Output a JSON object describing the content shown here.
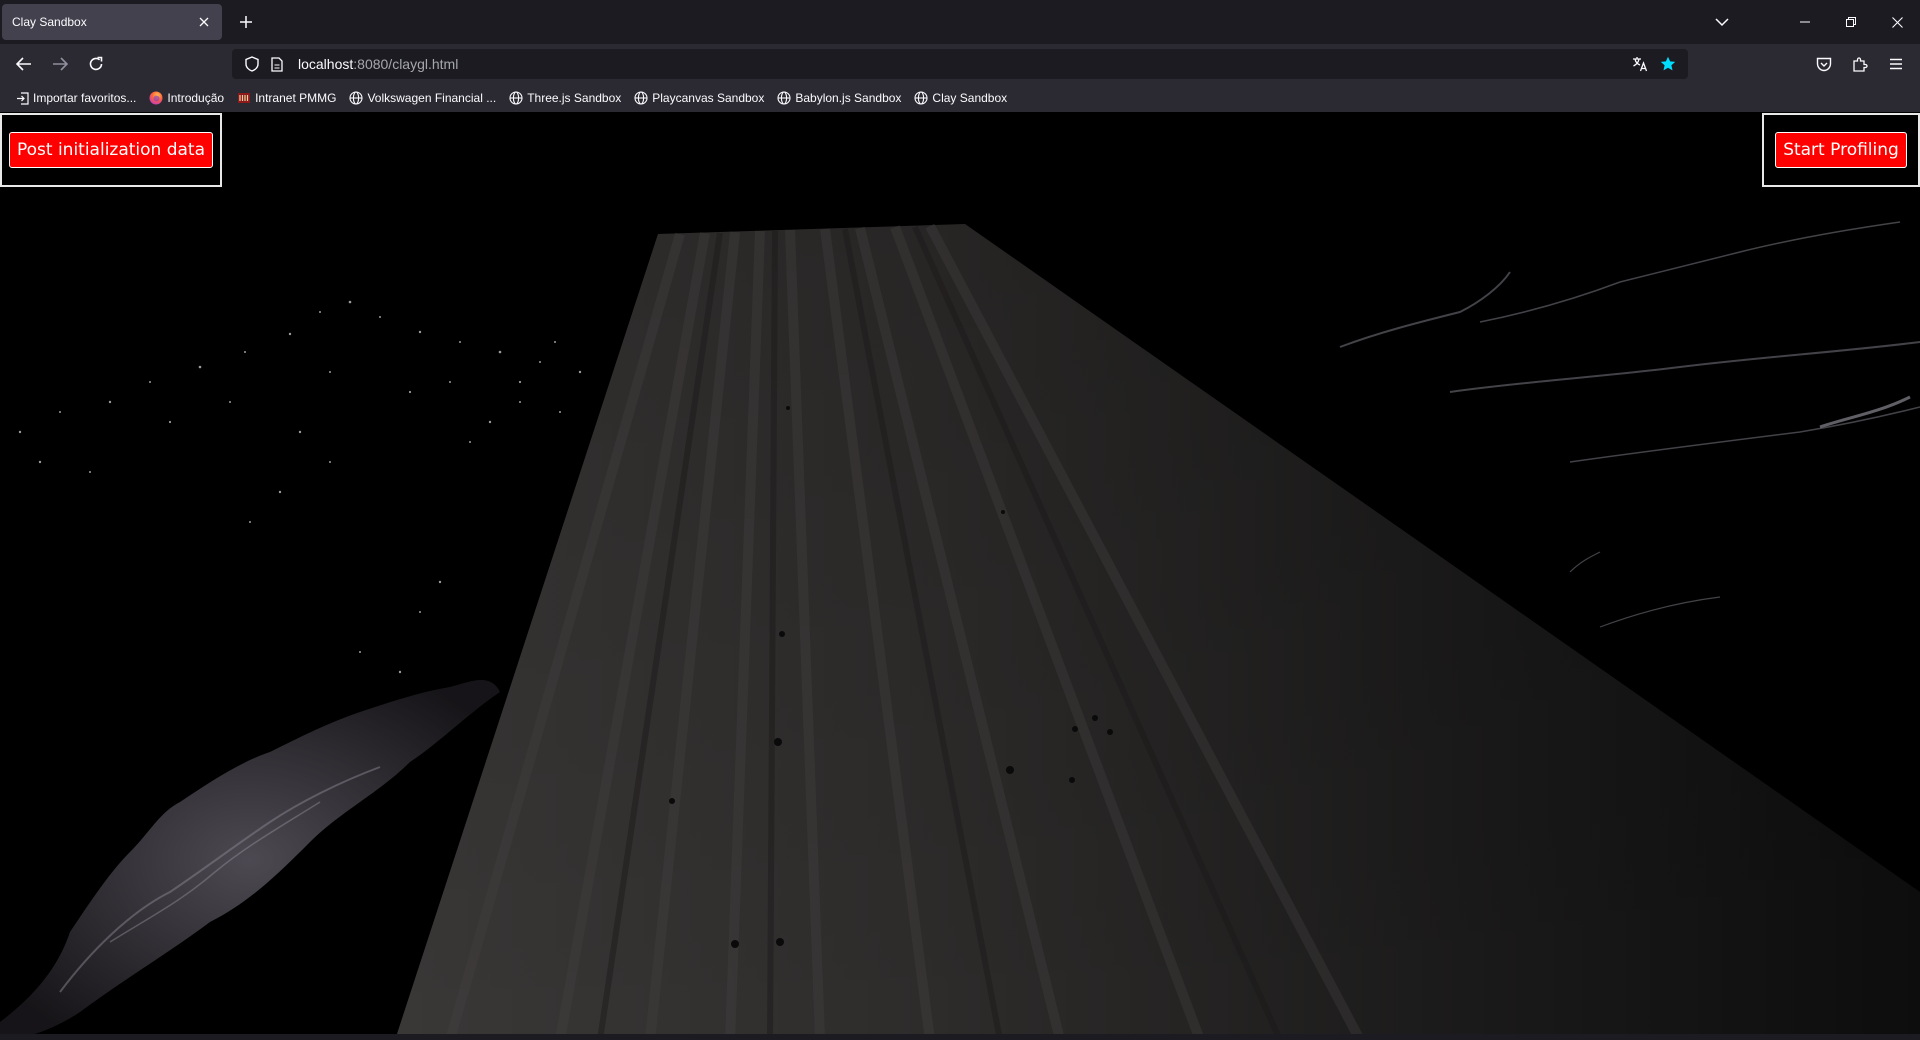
{
  "tab": {
    "title": "Clay Sandbox"
  },
  "urlbar": {
    "host": "localhost",
    "rest": ":8080/claygl.html"
  },
  "bookmarks": [
    {
      "label": "Importar favoritos...",
      "icon": "import-icon"
    },
    {
      "label": "Introdução",
      "icon": "firefox-icon"
    },
    {
      "label": "Intranet PMMG",
      "icon": "pmmg-icon"
    },
    {
      "label": "Volkswagen Financial ...",
      "icon": "globe-icon"
    },
    {
      "label": "Three.js Sandbox",
      "icon": "globe-icon"
    },
    {
      "label": "Playcanvas Sandbox",
      "icon": "globe-icon"
    },
    {
      "label": "Babylon.js Sandbox",
      "icon": "globe-icon"
    },
    {
      "label": "Clay Sandbox",
      "icon": "globe-icon"
    }
  ],
  "page": {
    "post_button": "Post initialization data",
    "profiling_button": "Start Profiling"
  },
  "colors": {
    "tab_bar": "#1c1b22",
    "toolbar": "#2b2a33",
    "accent_star": "#00ddff",
    "button_red": "#ff0000"
  }
}
